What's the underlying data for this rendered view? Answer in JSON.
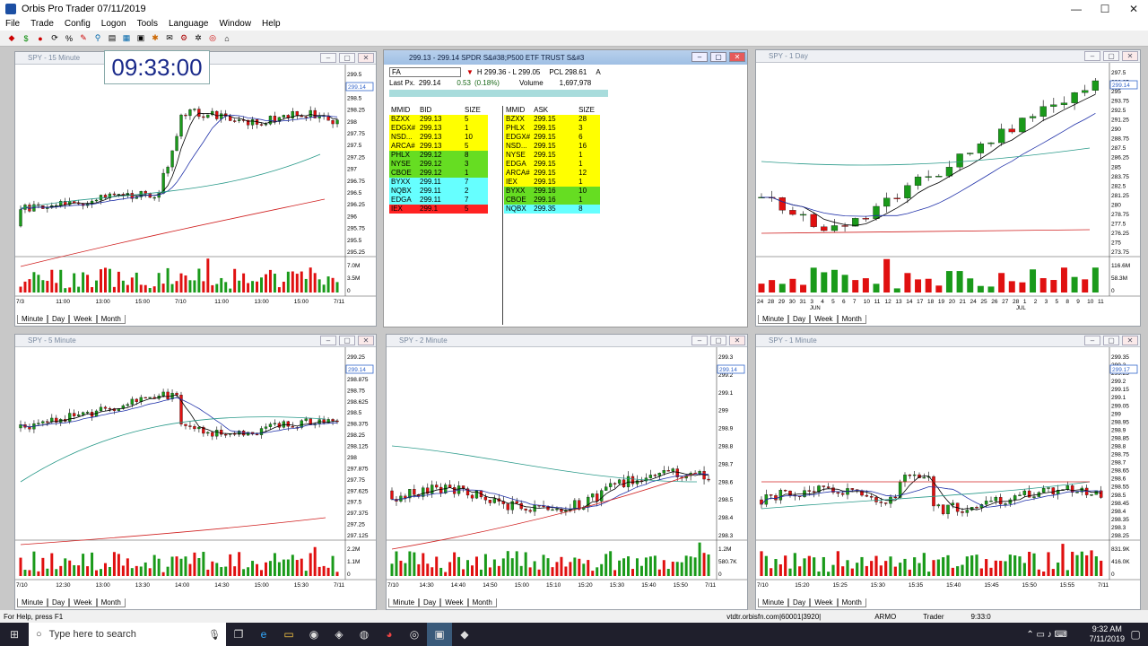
{
  "window": {
    "title": "Orbis Pro Trader  07/11/2019",
    "min": "—",
    "max": "☐",
    "close": "✕"
  },
  "menu": [
    "File",
    "Trade",
    "Config",
    "Logon",
    "Tools",
    "Language",
    "Window",
    "Help"
  ],
  "clock": "09:33:00",
  "panels": {
    "p15": {
      "title": "SPY - 15 Minute",
      "price": "299.14",
      "yticks": [
        "299.5",
        "298.75",
        "298.5",
        "298.25",
        "298",
        "297.75",
        "297.5",
        "297.25",
        "297",
        "296.75",
        "296.5",
        "296.25",
        "296",
        "295.75",
        "295.5",
        "295.25"
      ],
      "xticks": [
        "7/3",
        "11:00",
        "13:00",
        "15:00",
        "7/10",
        "11:00",
        "13:00",
        "15:00",
        "7/11"
      ],
      "vol": [
        "7.0M",
        "3.5M",
        "0"
      ]
    },
    "pday": {
      "title": "SPY - 1 Day",
      "price": "299.14",
      "yticks": [
        "297.5",
        "296.25",
        "295",
        "293.75",
        "292.5",
        "291.25",
        "290",
        "288.75",
        "287.5",
        "286.25",
        "285",
        "283.75",
        "282.5",
        "281.25",
        "280",
        "278.75",
        "277.5",
        "276.25",
        "275",
        "273.75"
      ],
      "xticks": [
        "24",
        "28",
        "29",
        "30",
        "31",
        "3",
        "4",
        "5",
        "6",
        "7",
        "10",
        "11",
        "12",
        "13",
        "14",
        "17",
        "18",
        "19",
        "20",
        "21",
        "24",
        "25",
        "26",
        "27",
        "28",
        "1",
        "2",
        "3",
        "5",
        "8",
        "9",
        "10",
        "11"
      ],
      "xsub": [
        "JUN",
        "JUL"
      ],
      "vol": [
        "116.6M",
        "58.3M",
        "0"
      ]
    },
    "p5": {
      "title": "SPY - 5 Minute",
      "price": "299.14",
      "yticks": [
        "299.25",
        "299",
        "298.875",
        "298.75",
        "298.625",
        "298.5",
        "298.375",
        "298.25",
        "298.125",
        "298",
        "297.875",
        "297.75",
        "297.625",
        "297.5",
        "297.375",
        "297.25",
        "297.125"
      ],
      "xticks": [
        "7/10",
        "12:30",
        "13:00",
        "13:30",
        "14:00",
        "14:30",
        "15:00",
        "15:30",
        "7/11"
      ],
      "vol": [
        "2.2M",
        "1.1M",
        "0"
      ]
    },
    "p2": {
      "title": "SPY - 2 Minute",
      "price": "299.14",
      "yticks": [
        "299.3",
        "299.2",
        "299.1",
        "299",
        "298.9",
        "298.8",
        "298.7",
        "298.6",
        "298.5",
        "298.4",
        "298.3"
      ],
      "xticks": [
        "7/10",
        "14:30",
        "14:40",
        "14:50",
        "15:00",
        "15:10",
        "15:20",
        "15:30",
        "15:40",
        "15:50",
        "7/11"
      ],
      "vol": [
        "1.2M",
        "580.7K",
        "0"
      ]
    },
    "p1": {
      "title": "SPY - 1 Minute",
      "price": "299.17",
      "yticks": [
        "299.35",
        "299.3",
        "299.25",
        "299.2",
        "299.15",
        "299.1",
        "299.05",
        "299",
        "298.95",
        "298.9",
        "298.85",
        "298.8",
        "298.75",
        "298.7",
        "298.65",
        "298.6",
        "298.55",
        "298.5",
        "298.45",
        "298.4",
        "298.35",
        "298.3",
        "298.25"
      ],
      "xticks": [
        "7/10",
        "15:20",
        "15:25",
        "15:30",
        "15:35",
        "15:40",
        "15:45",
        "15:50",
        "15:55",
        "7/11"
      ],
      "vol": [
        "831.9K",
        "416.0K",
        "0"
      ]
    }
  },
  "tabs": [
    "Minute",
    "Day",
    "Week",
    "Month"
  ],
  "quote": {
    "title": "299.13 - 299.14   SPDR S&#38;P500 ETF TRUST S&#3",
    "symbol": "FA",
    "hilo": "H 299.36 - L 299.05",
    "pcl": "PCL 298.61",
    "alert": "A",
    "last_label": "Last Px.",
    "last": "299.14",
    "chg": "0.53",
    "chgpct": "(0.18%)",
    "vol_label": "Volume",
    "vol": "1,697,978",
    "bid_headers": [
      "MMID",
      "BID",
      "SIZE"
    ],
    "ask_headers": [
      "MMID",
      "ASK",
      "SIZE"
    ],
    "bids": [
      [
        "BZXX",
        "299.13",
        "5",
        "#ffff00"
      ],
      [
        "EDGX#",
        "299.13",
        "1",
        "#ffff00"
      ],
      [
        "NSD...",
        "299.13",
        "10",
        "#ffff00"
      ],
      [
        "ARCA#",
        "299.13",
        "5",
        "#ffff00"
      ],
      [
        "PHLX",
        "299.12",
        "8",
        "#66dd22"
      ],
      [
        "NYSE",
        "299.12",
        "3",
        "#66dd22"
      ],
      [
        "CBOE",
        "299.12",
        "1",
        "#66dd22"
      ],
      [
        "BYXX",
        "299.11",
        "7",
        "#66ffff"
      ],
      [
        "NQBX",
        "299.11",
        "2",
        "#66ffff"
      ],
      [
        "EDGA",
        "299.11",
        "7",
        "#66ffff"
      ],
      [
        "IEX",
        "299.1",
        "5",
        "#ff2222"
      ]
    ],
    "asks": [
      [
        "BZXX",
        "299.15",
        "28",
        "#ffff00"
      ],
      [
        "PHLX",
        "299.15",
        "3",
        "#ffff00"
      ],
      [
        "EDGX#",
        "299.15",
        "6",
        "#ffff00"
      ],
      [
        "NSD...",
        "299.15",
        "16",
        "#ffff00"
      ],
      [
        "NYSE",
        "299.15",
        "1",
        "#ffff00"
      ],
      [
        "EDGA",
        "299.15",
        "1",
        "#ffff00"
      ],
      [
        "ARCA#",
        "299.15",
        "12",
        "#ffff00"
      ],
      [
        "IEX",
        "299.15",
        "1",
        "#ffff00"
      ],
      [
        "BYXX",
        "299.16",
        "10",
        "#66dd22"
      ],
      [
        "CBOE",
        "299.16",
        "1",
        "#66dd22"
      ],
      [
        "NQBX",
        "299.35",
        "8",
        "#66ffff"
      ]
    ]
  },
  "status": {
    "help": "For Help, press F1",
    "server": "vtdtr.orbisfn.com|60001|3920|",
    "user": "ARMO",
    "role": "Trader",
    "time": "9:33:0"
  },
  "taskbar": {
    "search_placeholder": "Type here to search",
    "time": "9:32 AM",
    "date": "7/11/2019"
  }
}
